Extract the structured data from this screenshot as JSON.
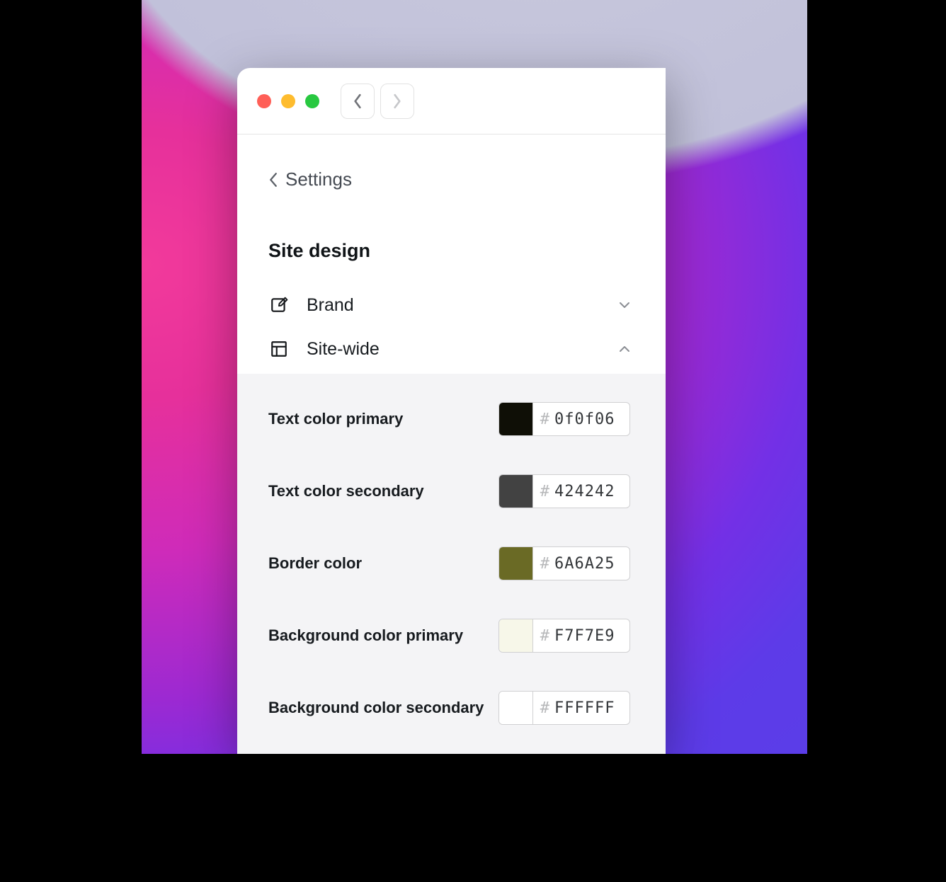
{
  "breadcrumb": {
    "label": "Settings"
  },
  "section_title": "Site design",
  "sections": [
    {
      "label": "Brand",
      "icon": "edit-icon",
      "expanded": false
    },
    {
      "label": "Site-wide",
      "icon": "layout-icon",
      "expanded": true
    }
  ],
  "properties": [
    {
      "label": "Text color primary",
      "hex": "0f0f06",
      "swatch": "#0f0f06"
    },
    {
      "label": "Text color secondary",
      "hex": "424242",
      "swatch": "#424242"
    },
    {
      "label": "Border color",
      "hex": "6A6A25",
      "swatch": "#6A6A25"
    },
    {
      "label": "Background color primary",
      "hex": "F7F7E9",
      "swatch": "#F7F7E9"
    },
    {
      "label": "Background color secondary",
      "hex": "FFFFFF",
      "swatch": "#FFFFFF"
    }
  ]
}
